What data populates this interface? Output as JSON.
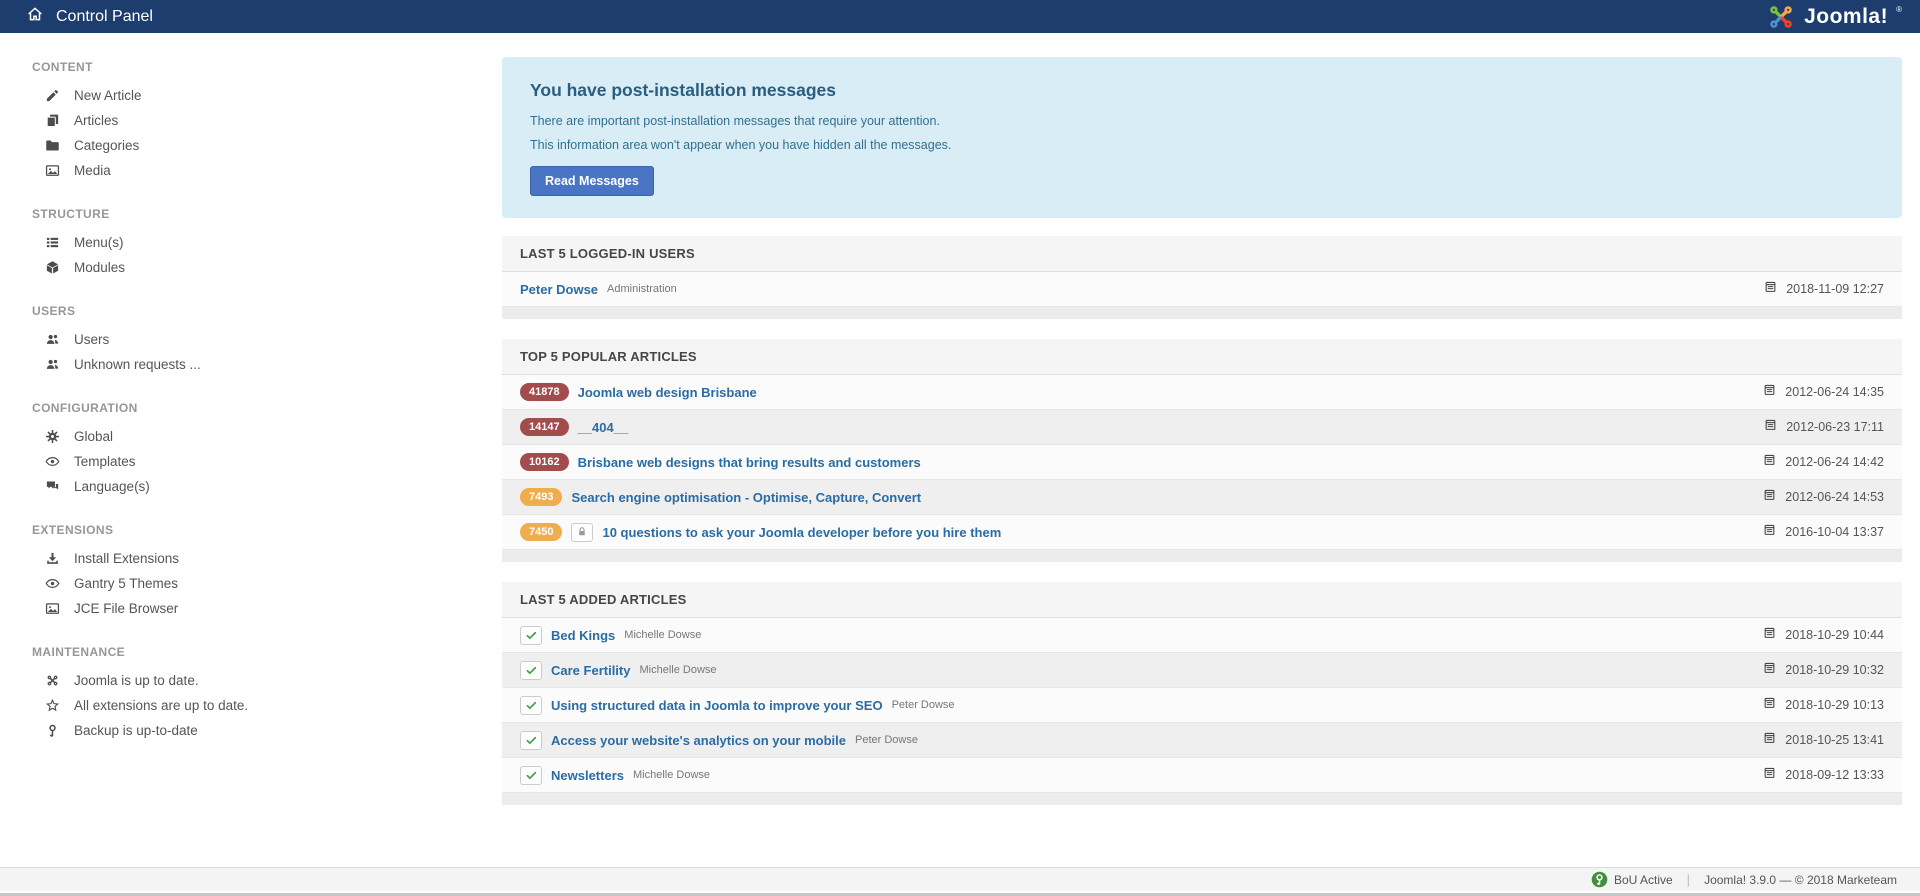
{
  "topbar": {
    "title": "Control Panel",
    "home_icon": "home-icon",
    "logo_text": "Joomla!",
    "logo_reg": "®"
  },
  "colors": {
    "topbar_bg": "#1c3d6e",
    "link_blue": "#2a6ca3",
    "info_bg": "#d9edf7",
    "button_blue": "#4a74c4",
    "badge_red": "#a24c4e",
    "badge_orange": "#f0ad4e",
    "footer_badge_green": "#3f8f3f"
  },
  "sidebar": {
    "sections": [
      {
        "label": "CONTENT",
        "items": [
          {
            "icon": "pencil-icon",
            "label": "New Article"
          },
          {
            "icon": "copy-icon",
            "label": "Articles"
          },
          {
            "icon": "folder-icon",
            "label": "Categories"
          },
          {
            "icon": "image-icon",
            "label": "Media"
          }
        ]
      },
      {
        "label": "STRUCTURE",
        "items": [
          {
            "icon": "list-icon",
            "label": "Menu(s)"
          },
          {
            "icon": "cube-icon",
            "label": "Modules"
          }
        ]
      },
      {
        "label": "USERS",
        "items": [
          {
            "icon": "users-icon",
            "label": "Users"
          },
          {
            "icon": "users-icon",
            "label": "Unknown requests ..."
          }
        ]
      },
      {
        "label": "CONFIGURATION",
        "items": [
          {
            "icon": "gear-icon",
            "label": "Global"
          },
          {
            "icon": "eye-icon",
            "label": "Templates"
          },
          {
            "icon": "comments-icon",
            "label": "Language(s)"
          }
        ]
      },
      {
        "label": "EXTENSIONS",
        "items": [
          {
            "icon": "download-icon",
            "label": "Install Extensions"
          },
          {
            "icon": "eye-icon",
            "label": "Gantry 5 Themes"
          },
          {
            "icon": "image-icon",
            "label": "JCE File Browser"
          }
        ]
      },
      {
        "label": "MAINTENANCE",
        "items": [
          {
            "icon": "joomla-icon",
            "label": "Joomla is up to date."
          },
          {
            "icon": "star-icon",
            "label": "All extensions are up to date."
          },
          {
            "icon": "akeeba-icon",
            "label": "Backup is up-to-date"
          }
        ]
      }
    ]
  },
  "message_box": {
    "title": "You have post-installation messages",
    "line1": "There are important post-installation messages that require your attention.",
    "line2": "This information area won't appear when you have hidden all the messages.",
    "button_label": "Read Messages"
  },
  "panels": {
    "logged_in": {
      "title": "LAST 5 LOGGED-IN USERS",
      "rows": [
        {
          "name": "Peter Dowse",
          "meta": "Administration",
          "date": "2018-11-09 12:27"
        }
      ]
    },
    "popular": {
      "title": "TOP 5 POPULAR ARTICLES",
      "rows": [
        {
          "hits": "41878",
          "title": "Joomla web design Brisbane",
          "date": "2012-06-24 14:35",
          "locked": false
        },
        {
          "hits": "14147",
          "title": "__404__",
          "date": "2012-06-23 17:11",
          "locked": false
        },
        {
          "hits": "10162",
          "title": "Brisbane web designs that bring results and customers",
          "date": "2012-06-24 14:42",
          "locked": false
        },
        {
          "hits": "7493",
          "title": "Search engine optimisation - Optimise, Capture, Convert",
          "date": "2012-06-24 14:53",
          "locked": false
        },
        {
          "hits": "7450",
          "title": "10 questions to ask your Joomla developer before you hire them",
          "date": "2016-10-04 13:37",
          "locked": true
        }
      ]
    },
    "added": {
      "title": "LAST 5 ADDED ARTICLES",
      "rows": [
        {
          "title": "Bed Kings",
          "author": "Michelle Dowse",
          "date": "2018-10-29 10:44"
        },
        {
          "title": "Care Fertility",
          "author": "Michelle Dowse",
          "date": "2018-10-29 10:32"
        },
        {
          "title": "Using structured data in Joomla to improve your SEO",
          "author": "Peter Dowse",
          "date": "2018-10-29 10:13"
        },
        {
          "title": "Access your website's analytics on your mobile",
          "author": "Peter Dowse",
          "date": "2018-10-25 13:41"
        },
        {
          "title": "Newsletters",
          "author": "Michelle Dowse",
          "date": "2018-09-12 13:33"
        }
      ]
    }
  },
  "footer": {
    "badge_label": "BoU Active",
    "divider": "|",
    "version_text": "Joomla! 3.9.0 — © 2018 Marketeam"
  }
}
